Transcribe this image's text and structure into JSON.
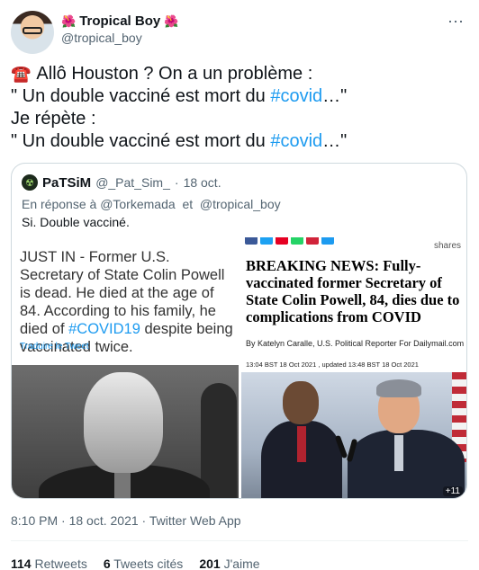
{
  "author": {
    "name": "Tropical Boy",
    "handle": "@tropical_boy",
    "name_emoji_left": "🌺",
    "name_emoji_right": "🌺"
  },
  "more_icon": "⋯",
  "tweet": {
    "phone_icon": "☎️",
    "line1": "Allô Houston ? On a un problème :",
    "line2_prefix": "\" Un double vacciné est mort du ",
    "hashtag": "#covid",
    "line2_suffix": "…\"",
    "line3": "Je répète :",
    "line4_prefix": "\" Un double vacciné est mort du ",
    "line4_suffix": "…\""
  },
  "quote": {
    "name": "PaTSiM",
    "handle": "@_Pat_Sim_",
    "separator": "·",
    "date": "18 oct.",
    "reply_prefix": "En réponse à",
    "reply_to_1": "@Torkemada",
    "reply_and": "et",
    "reply_to_2": "@tropical_boy",
    "text": "Si. Double vacciné.",
    "left_card": {
      "text_before": "JUST IN - Former U.S. Secretary of State Colin Powell is dead. He died at the age of 84. According to his family, he died of ",
      "hashtag": "#COVID19",
      "text_after": " despite being vaccinated twice.",
      "translate": "Traduire le Tweet"
    },
    "right_card": {
      "shares_label": "shares",
      "headline": "BREAKING NEWS: Fully-vaccinated former Secretary of State Colin Powell, 84, dies due to complications from COVID",
      "byline": "By Katelyn Caralle, U.S. Political Reporter For Dailymail.com",
      "dates": "13:04 BST 18 Oct 2021 , updated 13:48 BST 18 Oct 2021",
      "plus_count": "+11"
    }
  },
  "meta": {
    "time": "8:10 PM",
    "separator": "·",
    "date": "18 oct. 2021",
    "source": "Twitter Web App"
  },
  "stats": {
    "retweets_count": "114",
    "retweets_label": "Retweets",
    "quotes_count": "6",
    "quotes_label": "Tweets cités",
    "likes_count": "201",
    "likes_label": "J'aime"
  },
  "colors": {
    "link": "#1d9bf0",
    "muted": "#536471",
    "border": "#cfd9de"
  }
}
